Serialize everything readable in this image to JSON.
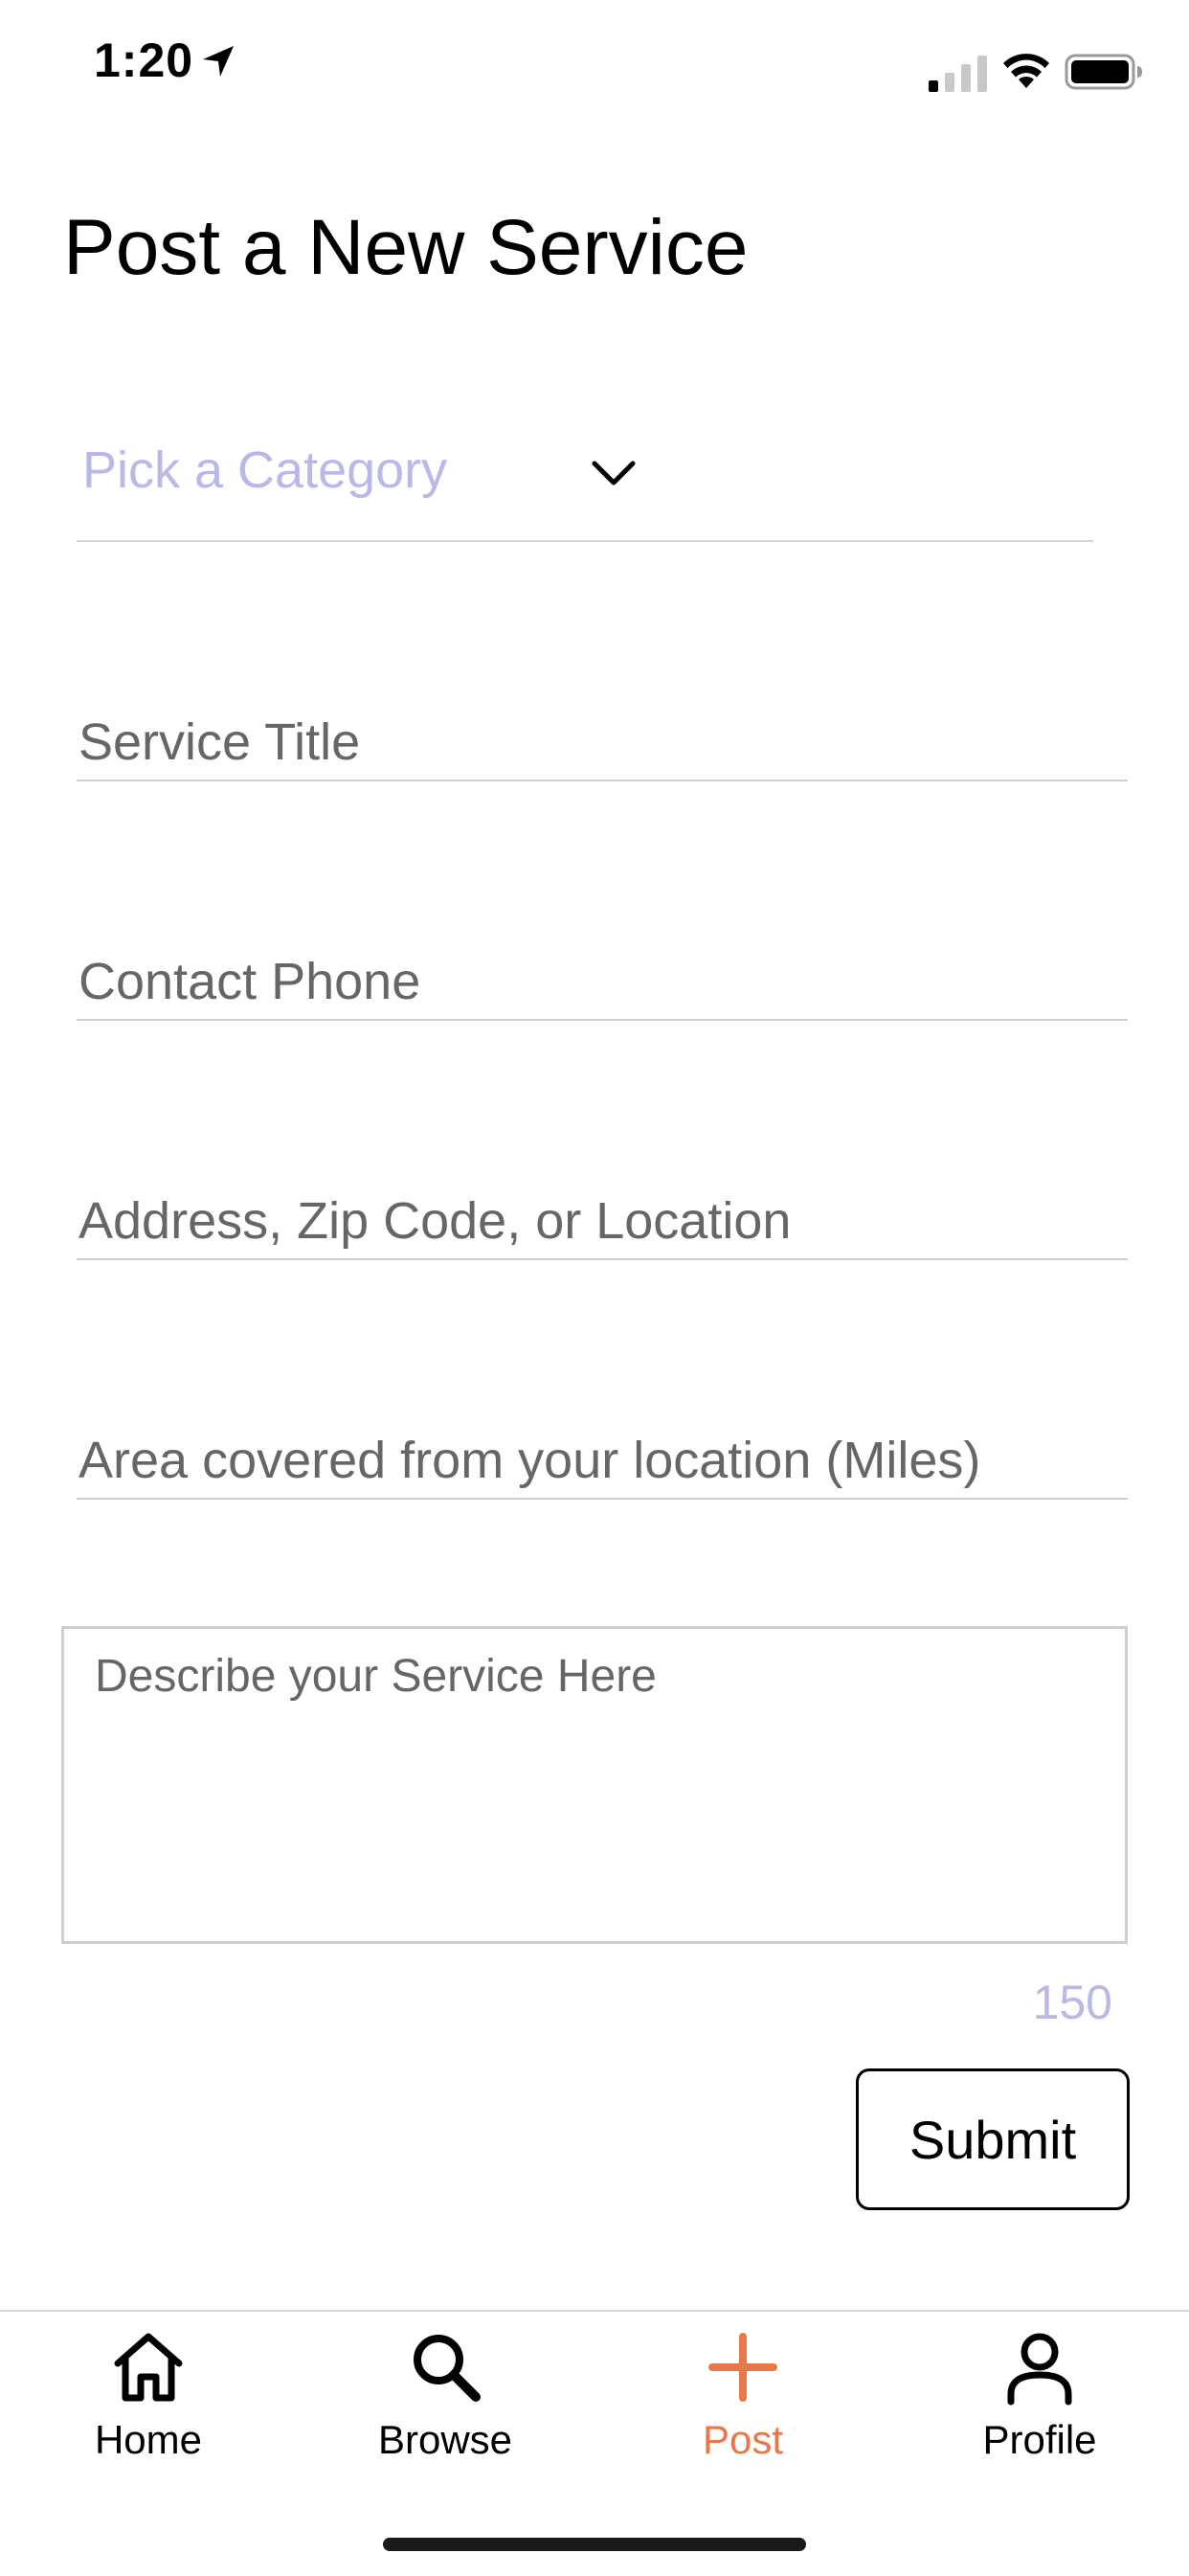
{
  "status_bar": {
    "time": "1:20",
    "icons": [
      "location-arrow-icon",
      "cellular-signal-icon",
      "wifi-icon",
      "battery-icon"
    ]
  },
  "page": {
    "title": "Post a New Service"
  },
  "form": {
    "category_placeholder": "Pick a Category",
    "service_title_placeholder": "Service Title",
    "contact_phone_placeholder": "Contact Phone",
    "address_placeholder": "Address, Zip Code, or Location",
    "area_placeholder": "Area covered from your location (Miles)",
    "description_placeholder": "Describe your Service Here",
    "char_count": "150",
    "submit_label": "Submit"
  },
  "tab_bar": {
    "active_tab": "Post",
    "active_color": "#e8774a",
    "items": [
      {
        "label": "Home",
        "icon": "home-icon"
      },
      {
        "label": "Browse",
        "icon": "search-icon"
      },
      {
        "label": "Post",
        "icon": "plus-icon"
      },
      {
        "label": "Profile",
        "icon": "profile-icon"
      }
    ]
  },
  "colors": {
    "placeholder_accent": "#b8b9e6",
    "divider": "#d6d6d6"
  }
}
